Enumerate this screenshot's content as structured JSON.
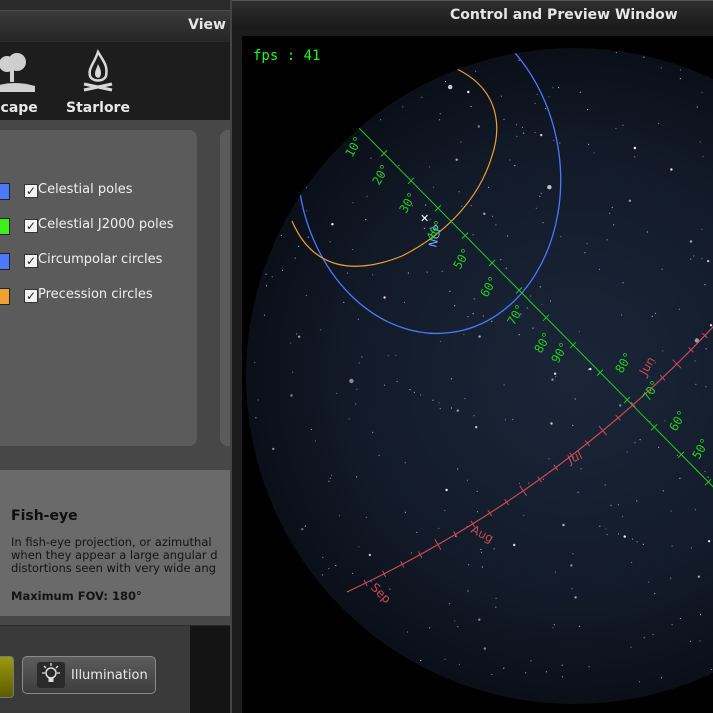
{
  "view_panel": {
    "title": "View",
    "close_icon": "close-icon",
    "tabs": [
      {
        "label": "scape",
        "icon": "landscape-icon"
      },
      {
        "label": "Starlore",
        "icon": "campfire-icon"
      }
    ],
    "markings": [
      {
        "label": "Celestial poles",
        "color": "#4a78ff",
        "checked": true
      },
      {
        "label": "Celestial J2000 poles",
        "color": "#3cf01e",
        "checked": true
      },
      {
        "label": "Circumpolar circles",
        "color": "#4a78ff",
        "checked": true
      },
      {
        "label": "Precession circles",
        "color": "#f0a030",
        "checked": true
      }
    ],
    "projection": {
      "title": "Fish-eye",
      "text_lines": [
        "In fish-eye projection, or azimuthal",
        "when they appear a large angular d",
        "distortions seen with very wide ang"
      ],
      "max_fov": "Maximum FOV: 180°"
    },
    "illumination_label": "Illumination",
    "illumination_icon": "lightbulb-icon"
  },
  "control_window": {
    "title": "Control and Preview Window",
    "fps": "fps : 41",
    "meridian_labels": [
      "10°",
      "20°",
      "30°",
      "40°",
      "50°",
      "60°",
      "70°",
      "80°",
      "90°",
      "80°",
      "70°",
      "60°",
      "50°"
    ],
    "ncp_label": "NCP",
    "ecliptic_labels": [
      "Jun",
      "Jul",
      "Aug",
      "Sep"
    ],
    "colors": {
      "meridian": "#22cc22",
      "ecliptic": "#c84a5a",
      "circumpolar": "#4a78ff",
      "precession": "#f0a030"
    }
  }
}
